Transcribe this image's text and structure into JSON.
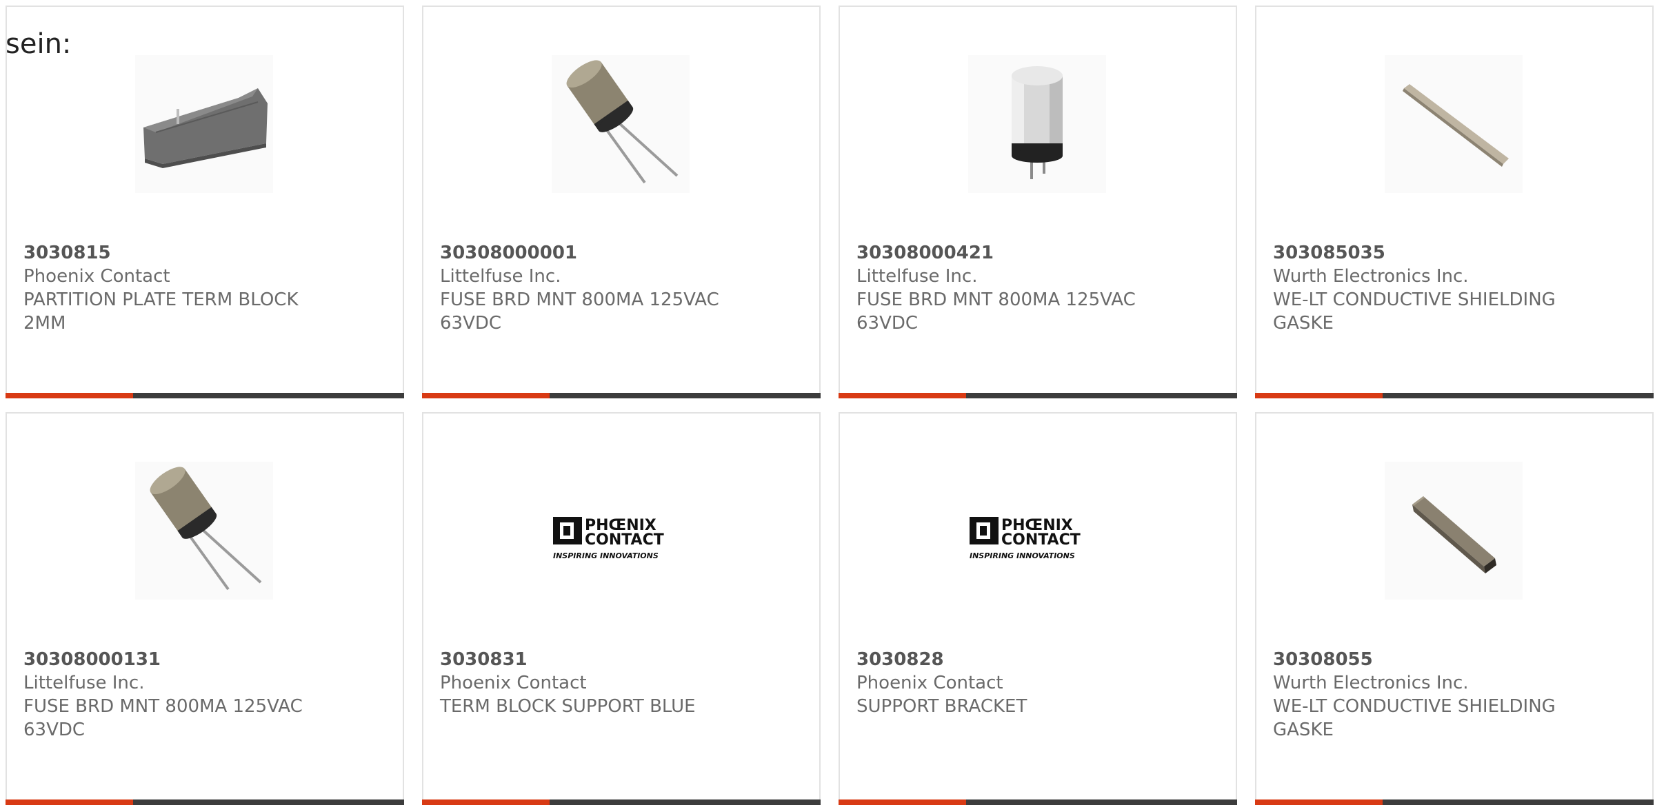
{
  "intro_text": "sein:",
  "colors": {
    "card_border": "#e2e2e2",
    "bar_dark": "#3c3c3c",
    "bar_accent": "#d83a14",
    "text": "#6a6a6a"
  },
  "products": [
    {
      "part_number": "3030815",
      "manufacturer": "Phoenix Contact",
      "description_line1": "PARTITION PLATE TERM BLOCK",
      "description_line2": "2MM",
      "image": "partition-plate-image",
      "bar_accent_fraction": 0.32
    },
    {
      "part_number": "30308000001",
      "manufacturer": "Littelfuse Inc.",
      "description_line1": "FUSE BRD MNT 800MA 125VAC",
      "description_line2": "63VDC",
      "image": "radial-fuse-image",
      "bar_accent_fraction": 0.32
    },
    {
      "part_number": "30308000421",
      "manufacturer": "Littelfuse Inc.",
      "description_line1": "FUSE BRD MNT 800MA 125VAC",
      "description_line2": "63VDC",
      "image": "upright-fuse-image",
      "bar_accent_fraction": 0.32
    },
    {
      "part_number": "303085035",
      "manufacturer": "Wurth Electronics Inc.",
      "description_line1": "WE-LT CONDUCTIVE SHIELDING",
      "description_line2": "GASKE",
      "image": "flat-gasket-image",
      "bar_accent_fraction": 0.32
    },
    {
      "part_number": "30308000131",
      "manufacturer": "Littelfuse Inc.",
      "description_line1": "FUSE BRD MNT 800MA 125VAC",
      "description_line2": "63VDC",
      "image": "radial-fuse-image",
      "bar_accent_fraction": 0.32
    },
    {
      "part_number": "3030831",
      "manufacturer": "Phoenix Contact",
      "description_line1": "TERM BLOCK SUPPORT BLUE",
      "description_line2": "",
      "image": "phoenix-contact-logo",
      "logo_line1": "PHŒNIX",
      "logo_line2": "CONTACT",
      "logo_tagline": "INSPIRING INNOVATIONS",
      "bar_accent_fraction": 0.32
    },
    {
      "part_number": "3030828",
      "manufacturer": "Phoenix Contact",
      "description_line1": "SUPPORT BRACKET",
      "description_line2": "",
      "image": "phoenix-contact-logo",
      "logo_line1": "PHŒNIX",
      "logo_line2": "CONTACT",
      "logo_tagline": "INSPIRING INNOVATIONS",
      "bar_accent_fraction": 0.32
    },
    {
      "part_number": "30308055",
      "manufacturer": "Wurth Electronics Inc.",
      "description_line1": "WE-LT CONDUCTIVE SHIELDING",
      "description_line2": "GASKE",
      "image": "square-gasket-image",
      "bar_accent_fraction": 0.32
    }
  ]
}
